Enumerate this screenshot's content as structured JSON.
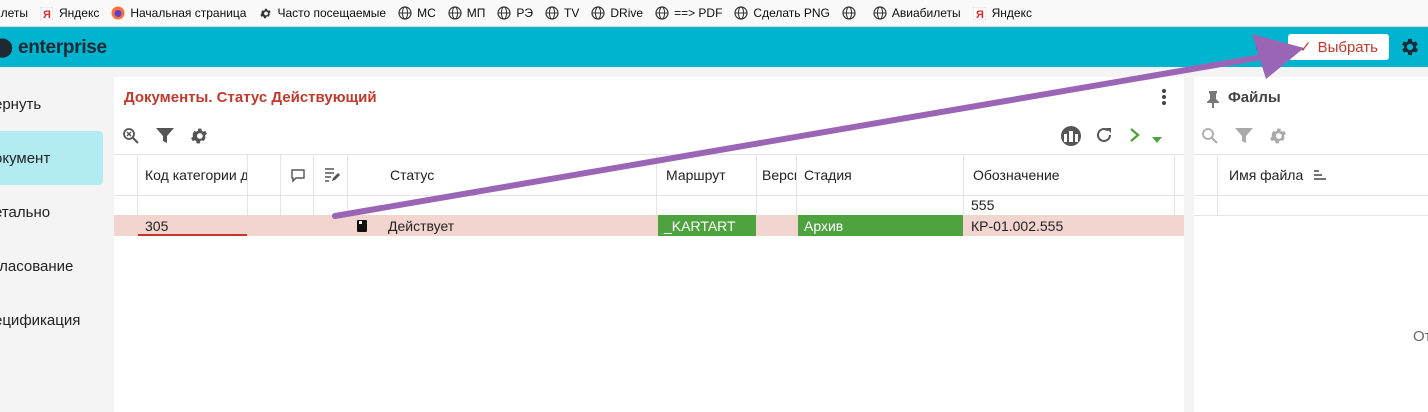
{
  "bookmarks": [
    {
      "label": "Билеты",
      "icon": "star-icon"
    },
    {
      "label": "Яндекс",
      "icon": "yandex-icon"
    },
    {
      "label": "Начальная страница",
      "icon": "firefox-icon"
    },
    {
      "label": "Часто посещаемые",
      "icon": "gear-icon"
    },
    {
      "label": "МС",
      "icon": "globe-icon"
    },
    {
      "label": "МП",
      "icon": "globe-icon"
    },
    {
      "label": "РЭ",
      "icon": "globe-icon"
    },
    {
      "label": "TV",
      "icon": "globe-icon"
    },
    {
      "label": "DRive",
      "icon": "globe-icon"
    },
    {
      "label": "==> PDF",
      "icon": "globe-icon"
    },
    {
      "label": "Сделать PNG",
      "icon": "globe-icon"
    },
    {
      "label": "",
      "icon": "globe-icon"
    },
    {
      "label": "Авиабилеты",
      "icon": "globe-icon"
    },
    {
      "label": "Яндекс",
      "icon": "yandex-icon"
    }
  ],
  "header": {
    "brand": "enterprise",
    "select_label": "Выбрать",
    "accent_color": "#00b4cf"
  },
  "sidebar": {
    "items": [
      {
        "label": "ернуть",
        "active": false
      },
      {
        "label": "окумент",
        "active": true
      },
      {
        "label": "етально",
        "active": false
      },
      {
        "label": "гласование",
        "active": false
      },
      {
        "label": "ецификация",
        "active": false
      }
    ]
  },
  "docs": {
    "title": "Документы. Статус Действующий",
    "columns": {
      "category": "Код категории д",
      "status": "Статус",
      "route": "Маршрут",
      "version": "Верси",
      "stage": "Стадия",
      "designation": "Обозначение"
    },
    "filter": {
      "designation": "555"
    },
    "row": {
      "category": "305",
      "status": "Действует",
      "route": "_KARTART",
      "stage": "Архив",
      "designation": "КР-01.002.555"
    }
  },
  "files": {
    "title": "Файлы",
    "columns": {
      "filename": "Имя файла"
    },
    "empty_text": "От"
  }
}
